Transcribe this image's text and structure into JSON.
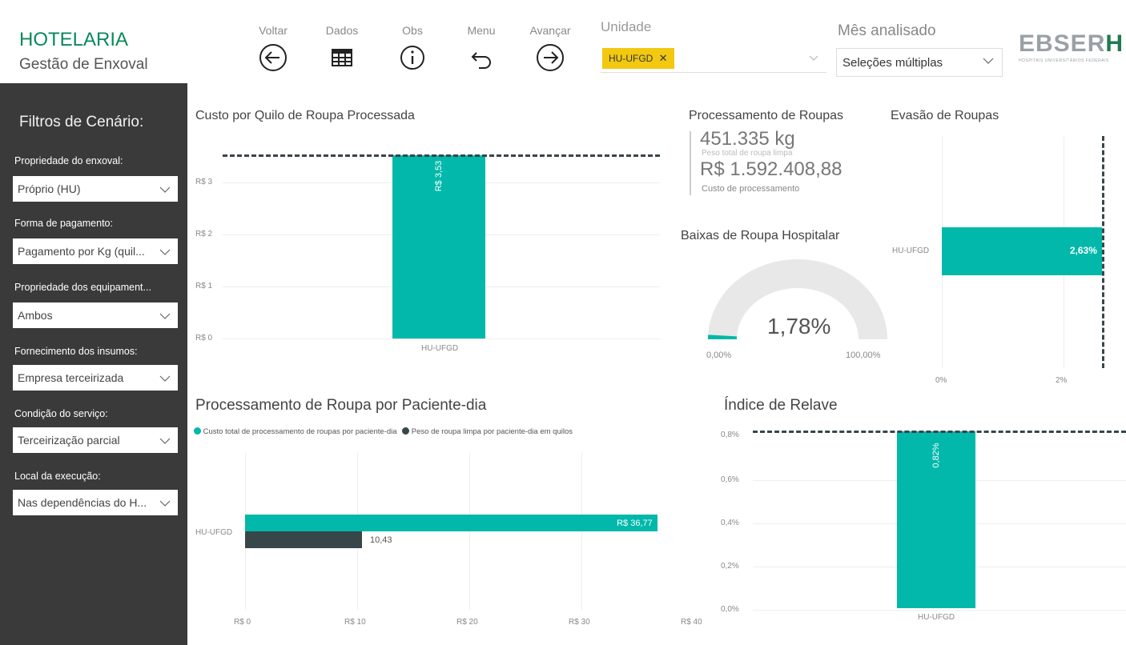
{
  "header": {
    "title": "HOTELARIA",
    "subtitle": "Gestão de Enxoval",
    "nav": {
      "voltar": "Voltar",
      "dados": "Dados",
      "obs": "Obs",
      "menu": "Menu",
      "avancar": "Avançar"
    },
    "unidade_label": "Unidade",
    "unidade_selected": "HU-UFGD",
    "mes_label": "Mês analisado",
    "mes_value": "Seleções múltiplas",
    "logo_text_a": "EBSER",
    "logo_text_b": "H",
    "logo_sub": "HOSPITAIS UNIVERSITÁRIOS FEDERAIS",
    "colors": {
      "accent": "#0a8a5c",
      "chip": "#f2c811",
      "teal": "#01b8aa",
      "dark": "#374649",
      "sidebar": "#3a3a3a"
    }
  },
  "sidebar": {
    "title": "Filtros de Cenário:",
    "filters": [
      {
        "label": "Propriedade do enxoval:",
        "value": "Próprio (HU)"
      },
      {
        "label": "Forma de pagamento:",
        "value": "Pagamento por Kg (quil..."
      },
      {
        "label": "Propriedade dos equipament...",
        "value": "Ambos"
      },
      {
        "label": "Fornecimento dos insumos:",
        "value": "Empresa terceirizada"
      },
      {
        "label": "Condição do serviço:",
        "value": "Terceirização parcial"
      },
      {
        "label": "Local da execução:",
        "value": "Nas dependências do H..."
      }
    ]
  },
  "cards": {
    "processamento_title": "Processamento de Roupas",
    "peso_value": "451.335 kg",
    "peso_label": "Peso total de roupa limpa",
    "custo_value": "R$ 1.592.408,88",
    "custo_label": "Custo de processamento",
    "gauge_title": "Baixas de Roupa Hospitalar",
    "gauge_value_label": "1,78%",
    "gauge_value": 1.78,
    "gauge_min": "0,00%",
    "gauge_max": "100,00%"
  },
  "chart_data": [
    {
      "type": "bar",
      "title": "Custo por Quilo de Roupa Processada",
      "categories": [
        "HU-UFGD"
      ],
      "values": [
        3.53
      ],
      "data_labels": [
        "R$ 3,53"
      ],
      "yticks": [
        "R$ 3",
        "R$ 2",
        "R$ 1",
        "R$ 0"
      ],
      "ylim": [
        0,
        3.8
      ],
      "reference_line": 3.53
    },
    {
      "type": "bar",
      "orientation": "horizontal",
      "title": "Evasão de Roupas",
      "categories": [
        "HU-UFGD"
      ],
      "values": [
        2.63
      ],
      "data_labels": [
        "2,63%"
      ],
      "xticks": [
        "0%",
        "2%"
      ],
      "xlim": [
        0,
        2.7
      ],
      "reference_line": 2.63
    },
    {
      "type": "bar",
      "orientation": "horizontal",
      "title": "Processamento de Roupa por Paciente-dia",
      "categories": [
        "HU-UFGD"
      ],
      "series": [
        {
          "name": "Custo total de processamento de roupas por paciente-dia",
          "values": [
            36.77
          ],
          "label": "R$ 36,77",
          "color": "#01b8aa"
        },
        {
          "name": "Peso de roupa limpa por paciente-dia em quilos",
          "values": [
            10.43
          ],
          "label": "10,43",
          "color": "#374649"
        }
      ],
      "xticks": [
        "R$ 0",
        "R$ 10",
        "R$ 20",
        "R$ 30",
        "R$ 40"
      ],
      "xlim": [
        0,
        40
      ],
      "legend": "top"
    },
    {
      "type": "bar",
      "title": "Índice de Relave",
      "categories": [
        "HU-UFGD"
      ],
      "values": [
        0.82
      ],
      "data_labels": [
        "0,82%"
      ],
      "yticks": [
        "0,8%",
        "0,6%",
        "0,4%",
        "0,2%",
        "0,0%"
      ],
      "ylim": [
        0,
        0.82
      ],
      "reference_line": 0.82
    }
  ]
}
